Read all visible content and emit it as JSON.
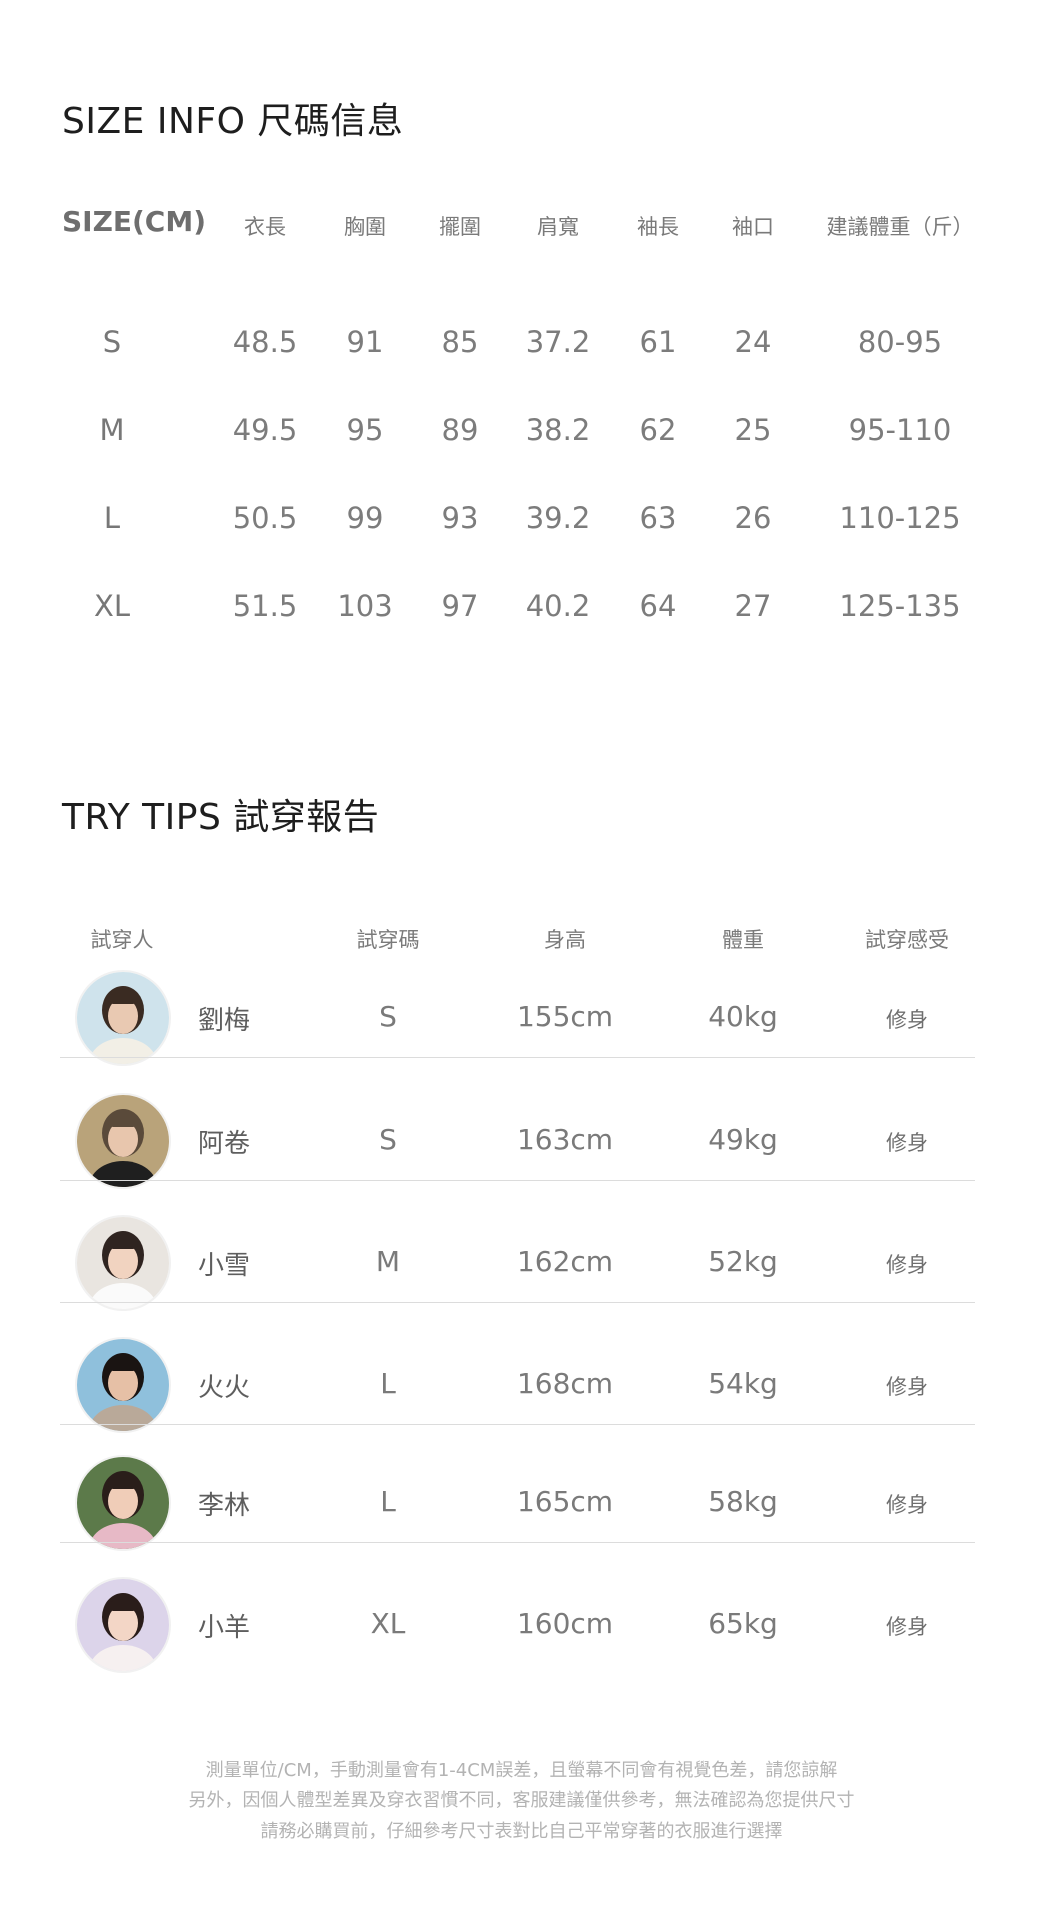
{
  "size_info": {
    "title": "SIZE INFO 尺碼信息",
    "headers": [
      "SIZE(CM)",
      "衣長",
      "胸圍",
      "擺圍",
      "肩寬",
      "袖長",
      "袖口",
      "建議體重（斤）"
    ],
    "rows": [
      [
        "S",
        "48.5",
        "91",
        "85",
        "37.2",
        "61",
        "24",
        "80-95"
      ],
      [
        "M",
        "49.5",
        "95",
        "89",
        "38.2",
        "62",
        "25",
        "95-110"
      ],
      [
        "L",
        "50.5",
        "99",
        "93",
        "39.2",
        "63",
        "26",
        "110-125"
      ],
      [
        "XL",
        "51.5",
        "103",
        "97",
        "40.2",
        "64",
        "27",
        "125-135"
      ]
    ]
  },
  "try_tips": {
    "title": "TRY TIPS 試穿報告",
    "headers": [
      "試穿人",
      "試穿碼",
      "身高",
      "體重",
      "試穿感受"
    ],
    "rows": [
      {
        "name": "劉梅",
        "size": "S",
        "height": "155cm",
        "weight": "40kg",
        "feel": "修身"
      },
      {
        "name": "阿卷",
        "size": "S",
        "height": "163cm",
        "weight": "49kg",
        "feel": "修身"
      },
      {
        "name": "小雪",
        "size": "M",
        "height": "162cm",
        "weight": "52kg",
        "feel": "修身"
      },
      {
        "name": "火火",
        "size": "L",
        "height": "168cm",
        "weight": "54kg",
        "feel": "修身"
      },
      {
        "name": "李林",
        "size": "L",
        "height": "165cm",
        "weight": "58kg",
        "feel": "修身"
      },
      {
        "name": "小羊",
        "size": "XL",
        "height": "160cm",
        "weight": "65kg",
        "feel": "修身"
      }
    ]
  },
  "footer_notes": [
    "測量單位/CM，手動測量會有1-4CM誤差，且螢幕不同會有視覺色差，請您諒解",
    "另外，因個人體型差異及穿衣習慣不同，客服建議僅供參考，無法確認為您提供尺寸",
    "請務必購買前，仔細參考尺寸表對比自己平常穿著的衣服進行選擇"
  ]
}
